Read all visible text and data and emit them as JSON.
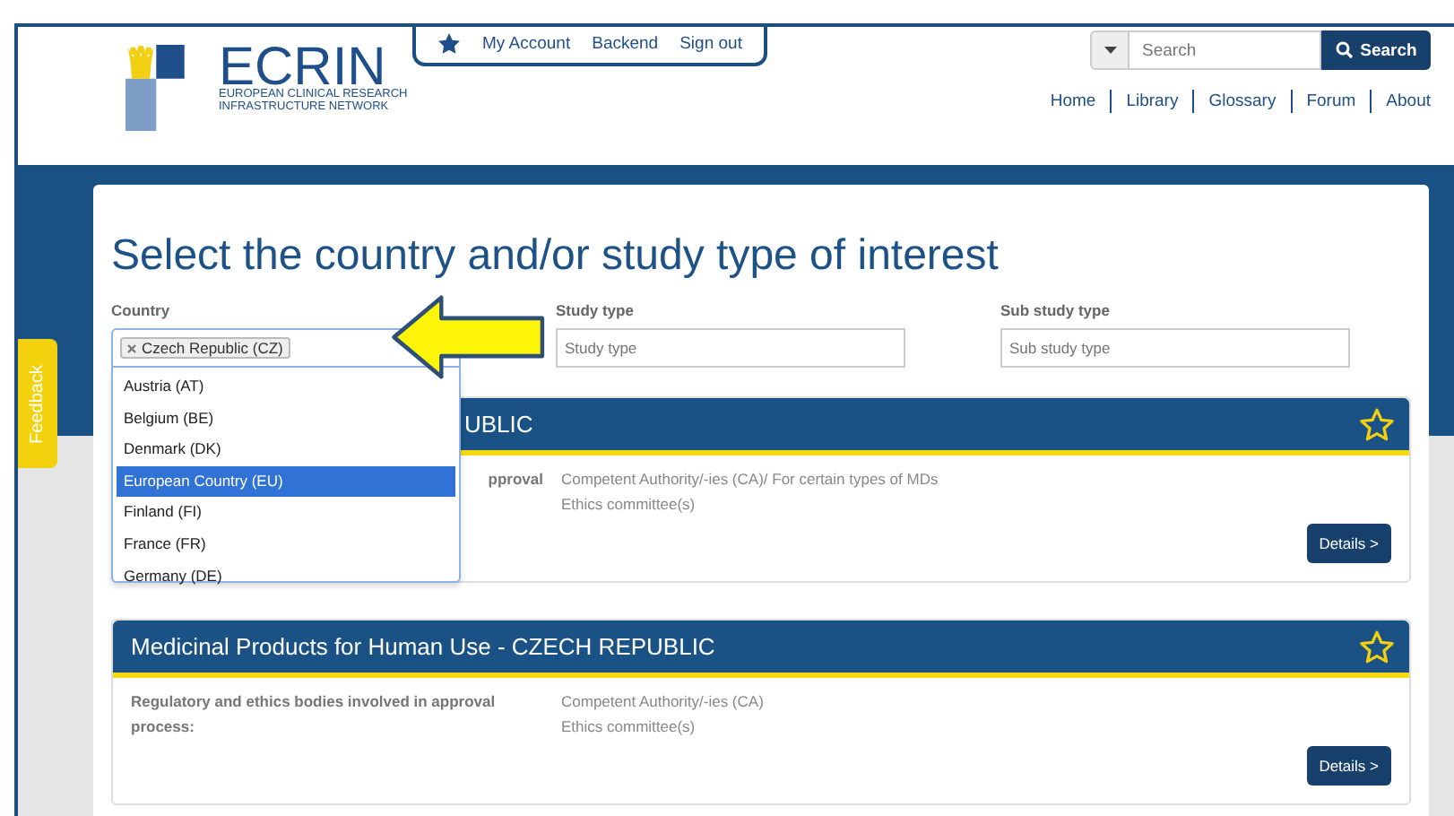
{
  "logo": {
    "name": "ECRIN",
    "subtitle_lines": [
      "EUROPEAN CLINICAL RESEARCH",
      "INFRASTRUCTURE NETWORK"
    ]
  },
  "account_links": [
    "My Account",
    "Backend",
    "Sign out"
  ],
  "search": {
    "placeholder": "Search",
    "button": "Search"
  },
  "nav": [
    "Home",
    "Library",
    "Glossary",
    "Forum",
    "About"
  ],
  "feedback": "Feedback",
  "heading": "Select the country and/or study type of interest",
  "filters": [
    {
      "label": "Country",
      "kind": "tags",
      "tags": [
        "Czech Republic (CZ)"
      ]
    },
    {
      "label": "Study type",
      "kind": "select",
      "placeholder": "Study type"
    },
    {
      "label": "Sub study type",
      "kind": "select",
      "placeholder": "Sub study type"
    }
  ],
  "dropdown": {
    "options": [
      {
        "label": "Austria (AT)",
        "selected": false
      },
      {
        "label": "Belgium (BE)",
        "selected": false
      },
      {
        "label": "Denmark (DK)",
        "selected": false
      },
      {
        "label": "European Country (EU)",
        "selected": true
      },
      {
        "label": "Finland (FI)",
        "selected": false
      },
      {
        "label": "France (FR)",
        "selected": false
      },
      {
        "label": "Germany (DE)",
        "selected": false
      }
    ]
  },
  "cards": [
    {
      "title": "UBLIC",
      "covered": true,
      "label": "pproval",
      "values": [
        "Competent Authority/-ies (CA)/ For certain types of MDs",
        "Ethics committee(s)"
      ],
      "button": "Details >"
    },
    {
      "title": "Medicinal Products for Human Use - CZECH REPUBLIC",
      "covered": false,
      "label": "Regulatory and ethics bodies involved in approval process:",
      "values": [
        "Competent Authority/-ies (CA)",
        "Ethics committee(s)"
      ],
      "button": "Details >"
    }
  ]
}
